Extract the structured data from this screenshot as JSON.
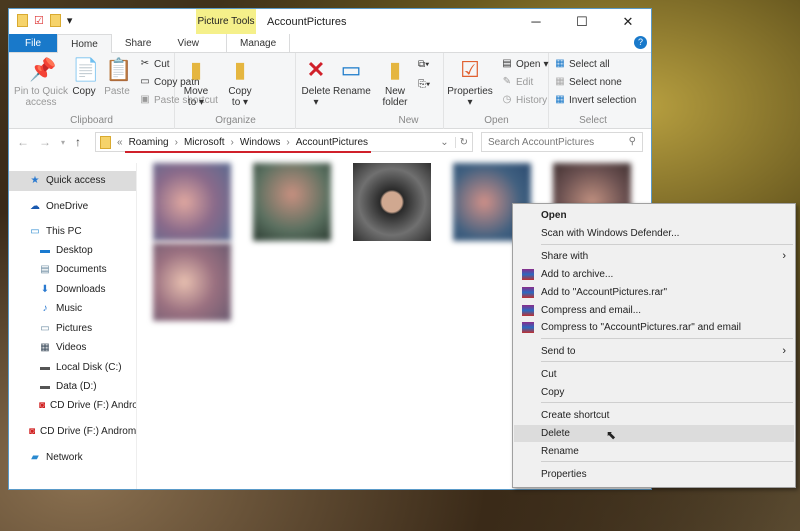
{
  "window": {
    "title": "AccountPictures",
    "picture_tools": "Picture Tools"
  },
  "tabs": [
    "File",
    "Home",
    "Share",
    "View",
    "Manage"
  ],
  "ribbon": {
    "clipboard": {
      "label": "Clipboard",
      "pin": "Pin to Quick access",
      "copy": "Copy",
      "paste": "Paste",
      "cut": "Cut",
      "copy_path": "Copy path",
      "paste_shortcut": "Paste shortcut"
    },
    "organize": {
      "label": "Organize",
      "move_to": "Move to",
      "copy_to": "Copy to",
      "delete": "Delete",
      "rename": "Rename"
    },
    "new": {
      "label": "New",
      "new_folder": "New folder"
    },
    "open": {
      "label": "Open",
      "properties": "Properties",
      "open": "Open",
      "edit": "Edit",
      "history": "History"
    },
    "select": {
      "label": "Select",
      "select_all": "Select all",
      "select_none": "Select none",
      "invert": "Invert selection"
    }
  },
  "address": {
    "crumbs": [
      "Roaming",
      "Microsoft",
      "Windows",
      "AccountPictures"
    ],
    "search_placeholder": "Search AccountPictures"
  },
  "sidebar": [
    {
      "label": "Quick access",
      "icon": "star-icon"
    },
    {
      "label": "OneDrive",
      "icon": "cloud-icon"
    },
    {
      "label": "This PC",
      "icon": "computer-icon"
    },
    {
      "label": "Desktop",
      "icon": "desktop-icon"
    },
    {
      "label": "Documents",
      "icon": "document-icon"
    },
    {
      "label": "Downloads",
      "icon": "download-icon"
    },
    {
      "label": "Music",
      "icon": "music-icon"
    },
    {
      "label": "Pictures",
      "icon": "pictures-icon"
    },
    {
      "label": "Videos",
      "icon": "video-icon"
    },
    {
      "label": "Local Disk (C:)",
      "icon": "disk-icon"
    },
    {
      "label": "Data (D:)",
      "icon": "disk-icon"
    },
    {
      "label": "CD Drive (F:) Andro",
      "icon": "cd-drive-icon"
    },
    {
      "label": "CD Drive (F:) Androm",
      "icon": "cd-drive-icon"
    },
    {
      "label": "Network",
      "icon": "network-icon"
    }
  ],
  "context_menu": [
    {
      "label": "Open"
    },
    {
      "label": "Scan with Windows Defender..."
    },
    {
      "label": "Share with",
      "submenu": true
    },
    {
      "label": "Add to archive...",
      "icon": "winrar-icon"
    },
    {
      "label": "Add to \"AccountPictures.rar\"",
      "icon": "winrar-icon"
    },
    {
      "label": "Compress and email...",
      "icon": "winrar-icon"
    },
    {
      "label": "Compress to \"AccountPictures.rar\" and email",
      "icon": "winrar-icon"
    },
    {
      "label": "Send to",
      "submenu": true
    },
    {
      "label": "Cut"
    },
    {
      "label": "Copy"
    },
    {
      "label": "Create shortcut"
    },
    {
      "label": "Delete",
      "highlighted": true
    },
    {
      "label": "Rename"
    },
    {
      "label": "Properties"
    }
  ],
  "colors": {
    "accent": "#1979ca",
    "underline": "#d0202a",
    "picture_tools": "#f5f08a"
  }
}
